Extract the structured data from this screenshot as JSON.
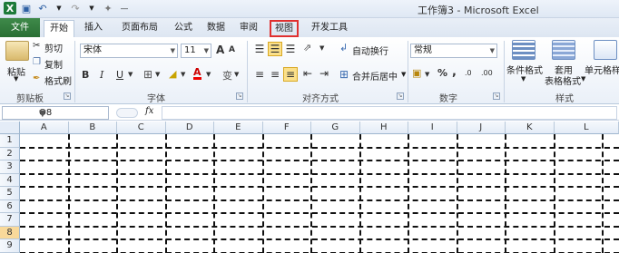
{
  "titlebar": {
    "title": "工作簿3 - Microsoft Excel",
    "icons": [
      "excel-logo",
      "save-icon",
      "undo-icon",
      "redo-icon",
      "customize-icon"
    ]
  },
  "tabs": [
    {
      "label": "文件"
    },
    {
      "label": "开始"
    },
    {
      "label": "插入"
    },
    {
      "label": "页面布局"
    },
    {
      "label": "公式"
    },
    {
      "label": "数据"
    },
    {
      "label": "审阅"
    },
    {
      "label": "视图"
    },
    {
      "label": "开发工具"
    }
  ],
  "ribbon": {
    "clipboard": {
      "paste": "粘贴",
      "cut": "剪切",
      "copy": "复制",
      "format_painter": "格式刷",
      "label": "剪贴板"
    },
    "font": {
      "name": "宋体",
      "size": "11",
      "bold": "B",
      "italic": "I",
      "underline": "U",
      "grow": "A",
      "shrink": "A",
      "font_color": "A",
      "phonetic": "变",
      "label": "字体"
    },
    "alignment": {
      "wrap": "自动换行",
      "merge": "合并后居中",
      "label": "对齐方式"
    },
    "number": {
      "format": "常规",
      "percent": "%",
      "comma": ",",
      "inc": ".0",
      "dec": ".00",
      "label": "数字"
    },
    "styles": {
      "conditional": "条件格式",
      "table_1": "套用",
      "table_2": "表格格式",
      "cell": "单元格样",
      "label": "样式"
    }
  },
  "formula_bar": {
    "name_box": "O8",
    "fx": "fx",
    "formula": ""
  },
  "grid": {
    "columns": [
      "A",
      "B",
      "C",
      "D",
      "E",
      "F",
      "G",
      "H",
      "I",
      "J",
      "K",
      "L"
    ],
    "rows": [
      "1",
      "2",
      "3",
      "4",
      "5",
      "6",
      "7",
      "8",
      "9"
    ],
    "selected_row": "8"
  },
  "colors": {
    "file_tab": "#2a6f34",
    "highlight": "#e03030",
    "accent": "#1d7a3a"
  }
}
